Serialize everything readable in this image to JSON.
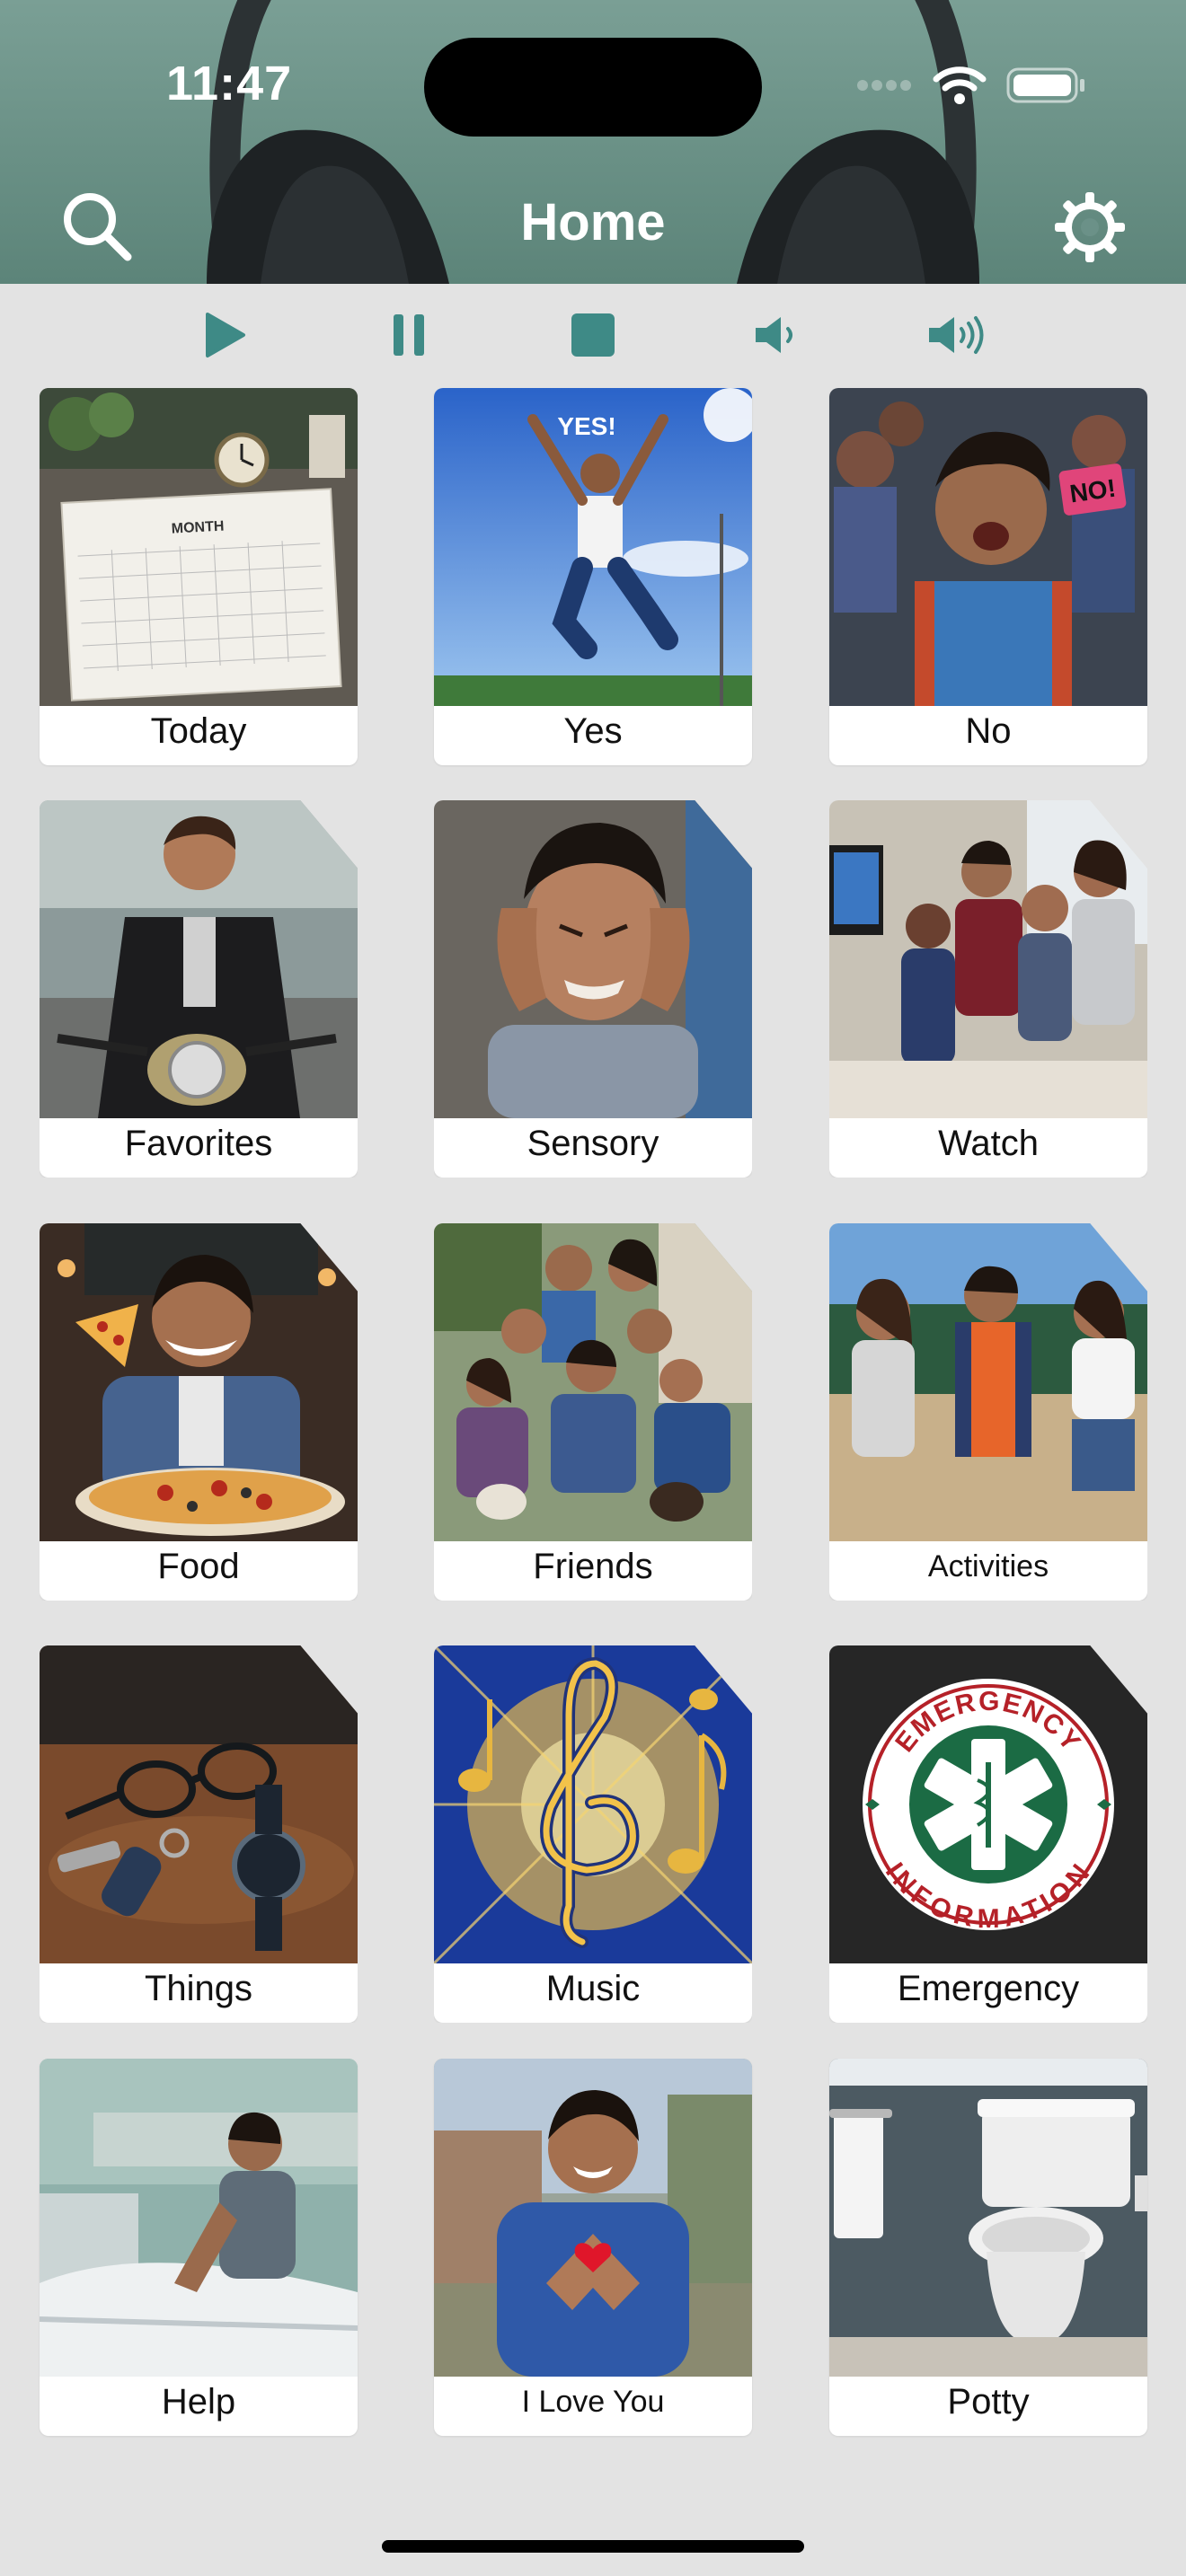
{
  "status": {
    "time": "11:47"
  },
  "header": {
    "title": "Home"
  },
  "icons": {
    "search": "search-icon",
    "settings": "gear-icon",
    "play": "play-icon",
    "pause": "pause-icon",
    "stop": "stop-icon",
    "volume_down": "volume-down-icon",
    "volume_up": "volume-up-icon"
  },
  "colors": {
    "header": "#6b9188",
    "accent": "#3e8a86",
    "background": "#e3e3e3"
  },
  "tiles": [
    {
      "label": "Today"
    },
    {
      "label": "Yes"
    },
    {
      "label": "No"
    },
    {
      "label": "Favorites"
    },
    {
      "label": "Sensory"
    },
    {
      "label": "Watch"
    },
    {
      "label": "Food"
    },
    {
      "label": "Friends"
    },
    {
      "label": "Activities"
    },
    {
      "label": "Things"
    },
    {
      "label": "Music"
    },
    {
      "label": "Emergency"
    },
    {
      "label": "Help"
    },
    {
      "label": "I Love You"
    },
    {
      "label": "Potty"
    }
  ],
  "emergency_badge": {
    "top_text": "EMERGENCY",
    "bottom_text": "INFORMATION"
  },
  "yes_image_text": "YES!",
  "no_image_text": "NO!",
  "calendar_text": "MONTH"
}
